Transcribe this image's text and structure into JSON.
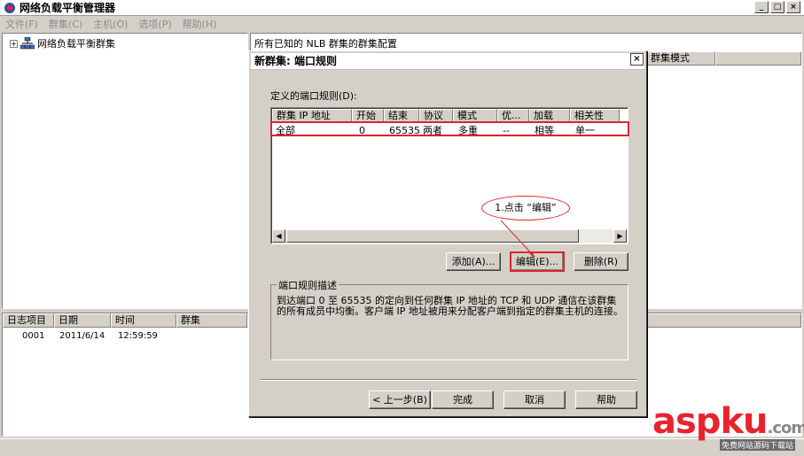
{
  "app": {
    "title": "网络负载平衡管理器"
  },
  "menu": [
    "文件(F)",
    "群集(C)",
    "主机(O)",
    "选项(P)",
    "帮助(H)"
  ],
  "tree": {
    "root_label": "网络负载平衡群集",
    "expander": "+"
  },
  "config": {
    "header": "所有已知的 NLB 群集的群集配置",
    "columns": [
      "群集模式"
    ]
  },
  "log": {
    "columns": [
      "日志项目",
      "日期",
      "时间",
      "群集"
    ],
    "rows": [
      {
        "id": "0001",
        "date": "2011/6/14",
        "time": "12:59:59",
        "cluster": ""
      }
    ]
  },
  "dialog": {
    "title": "新群集:  端口规则",
    "close": "×",
    "rules_label": "定义的端口规则(D):",
    "columns": [
      "群集 IP 地址",
      "开始",
      "结束",
      "协议",
      "模式",
      "优...",
      "加载",
      "相关性"
    ],
    "rows": [
      {
        "ip": "全部",
        "start": "0",
        "end": "65535",
        "protocol": "两者",
        "mode": "多重",
        "priority": "--",
        "load": "相等",
        "affinity": "单一"
      }
    ],
    "buttons": {
      "add": "添加(A)...",
      "edit": "编辑(E)...",
      "remove": "删除(R)"
    },
    "description_title": "端口规则描述",
    "description": "到达端口 0 至 65535 的定向到任何群集 IP 地址的 TCP 和 UDP 通信在该群集的所有成员中均衡。客户端 IP 地址被用来分配客户端到指定的群集主机的连接。",
    "nav": {
      "back": "< 上一步(B)",
      "finish": "完成",
      "cancel": "取消",
      "help": "帮助"
    }
  },
  "annotation": {
    "text": "1.点击 “编辑”"
  },
  "watermark": {
    "brand_a": "asp",
    "brand_b": "ku",
    "brand_c": ".com",
    "tagline": "免费网站源码下载站"
  },
  "colors": {
    "highlight": "#d9262e",
    "chrome": "#d4d0c8"
  }
}
